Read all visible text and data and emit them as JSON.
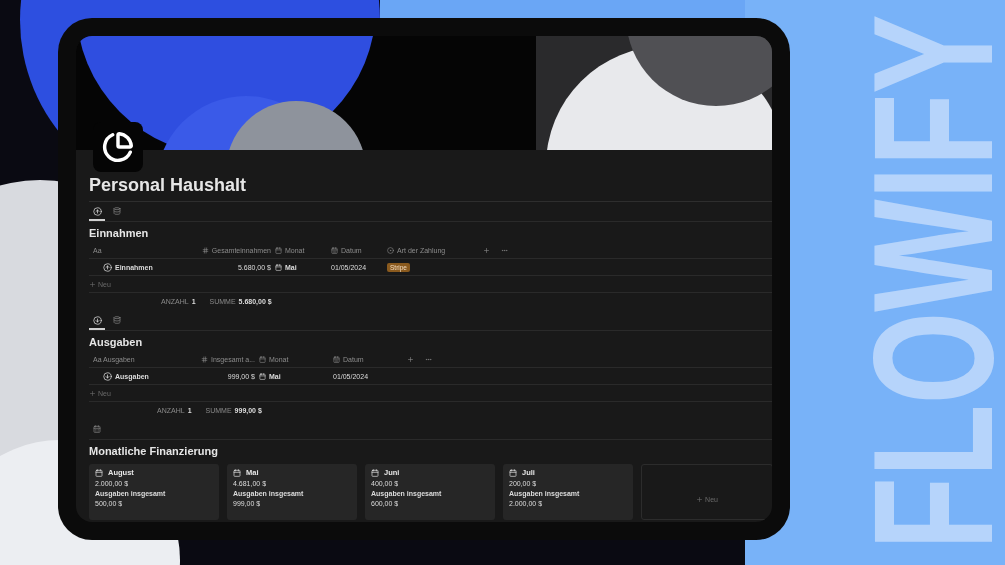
{
  "background": {
    "brand": "FLOWIFY"
  },
  "page": {
    "title": "Personal Haushalt"
  },
  "sections": [
    {
      "views": [
        {
          "kind": "up",
          "selected": true
        },
        {
          "kind": "db",
          "selected": false
        }
      ],
      "title": "Einnahmen",
      "columns": [
        {
          "kind": "title",
          "label": "Aa"
        },
        {
          "kind": "number",
          "label": "Gesamteinnahmen"
        },
        {
          "kind": "calendar",
          "label": "Monat"
        },
        {
          "kind": "date",
          "label": "Datum"
        },
        {
          "kind": "select",
          "label": "Art der Zahlung"
        }
      ],
      "rows": [
        {
          "cells": [
            "Einnahmen",
            "5.680,00 $",
            "Mai",
            "01/05/2024",
            "Stripe"
          ]
        }
      ],
      "new_label": "Neu",
      "footer": [
        {
          "label": "ANZAHL",
          "value": "1"
        },
        {
          "label": "SUMME",
          "value": "5.680,00 $"
        }
      ]
    },
    {
      "views": [
        {
          "kind": "down",
          "selected": true
        },
        {
          "kind": "db",
          "selected": false
        }
      ],
      "title": "Ausgaben",
      "columns": [
        {
          "kind": "title",
          "label": "Aa Ausgaben"
        },
        {
          "kind": "number",
          "label": "Insgesamt a..."
        },
        {
          "kind": "calendar",
          "label": "Monat"
        },
        {
          "kind": "date",
          "label": "Datum"
        }
      ],
      "rows": [
        {
          "cells": [
            "Ausgaben",
            "999,00 $",
            "Mai",
            "01/05/2024"
          ]
        }
      ],
      "new_label": "Neu",
      "footer": [
        {
          "label": "ANZAHL",
          "value": "1"
        },
        {
          "label": "SUMME",
          "value": "999,00 $"
        }
      ]
    }
  ],
  "gallery": {
    "title": "Monatliche Finanzierung",
    "cards": [
      {
        "month": "August",
        "amount": "2.000,00 $",
        "label": "Ausgaben insgesamt",
        "spent": "500,00 $"
      },
      {
        "month": "Mai",
        "amount": "4.681,00 $",
        "label": "Ausgaben insgesamt",
        "spent": "999,00 $"
      },
      {
        "month": "Juni",
        "amount": "400,00 $",
        "label": "Ausgaben insgesamt",
        "spent": "600,00 $"
      },
      {
        "month": "Juli",
        "amount": "200,00 $",
        "label": "Ausgaben insgesamt",
        "spent": "2.000,00 $"
      }
    ],
    "new_label": "Neu"
  }
}
